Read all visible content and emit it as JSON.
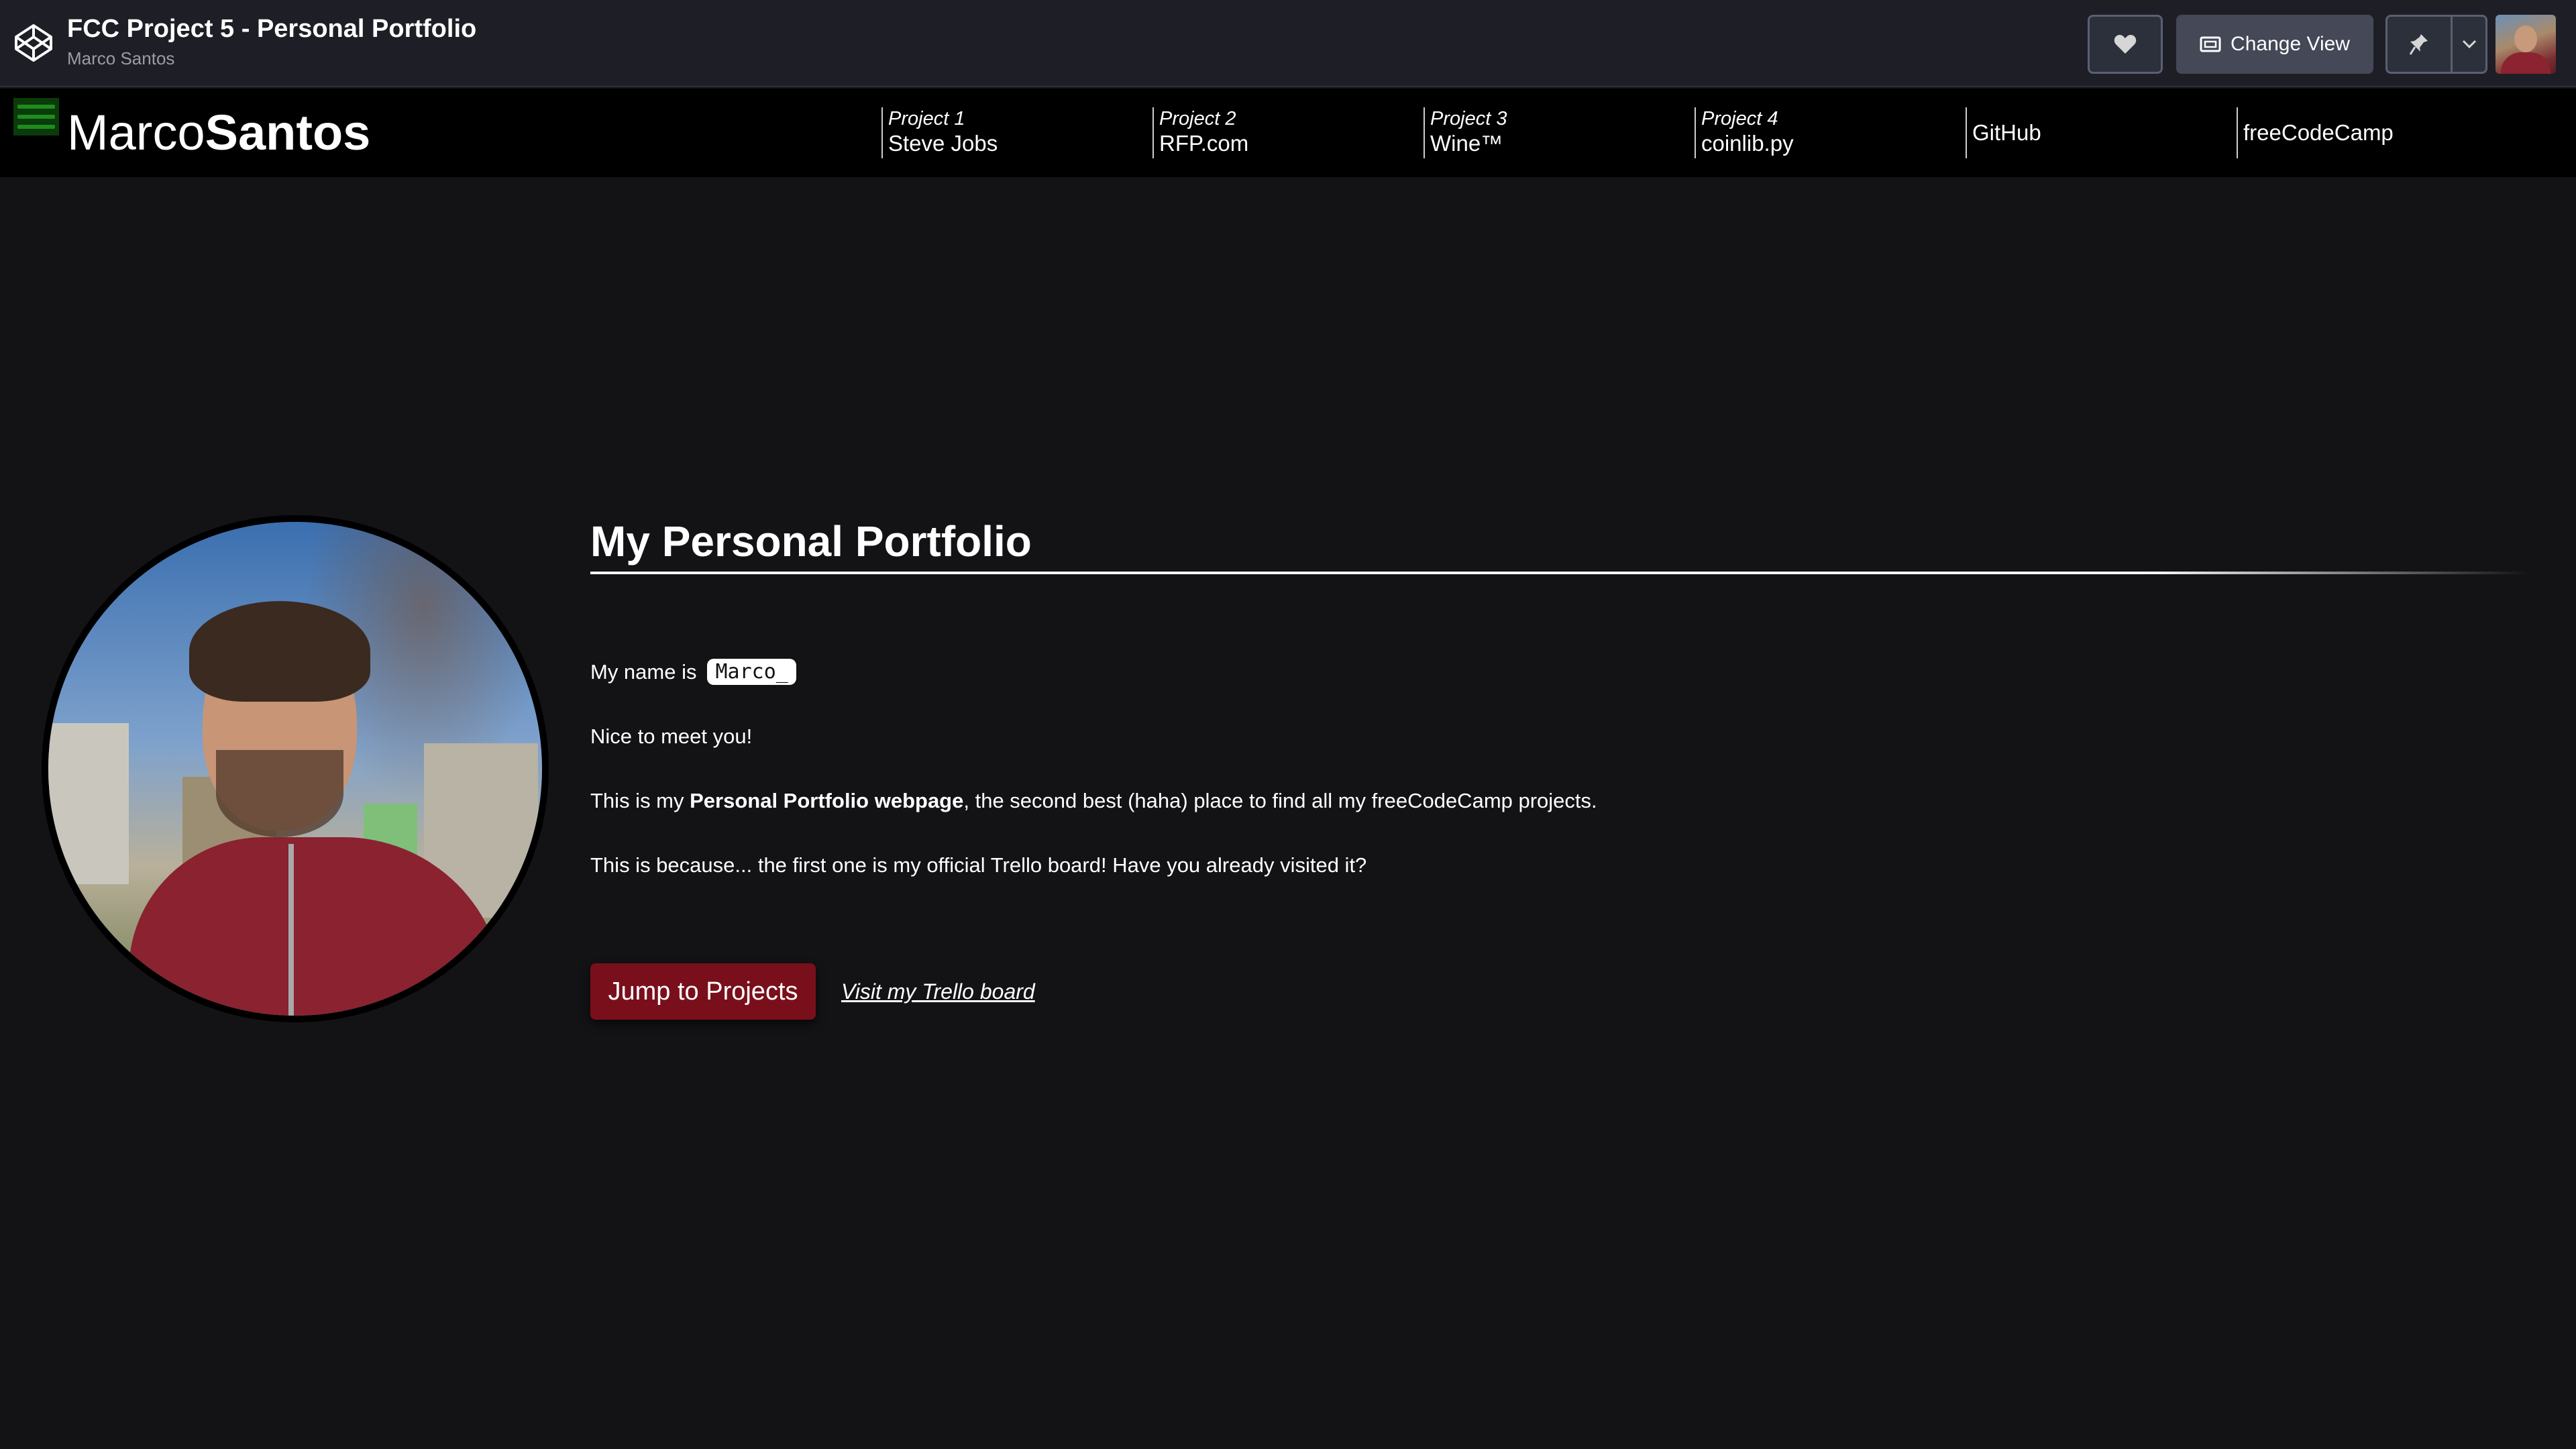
{
  "codepen_bar": {
    "pen_title": "FCC Project 5 - Personal Portfolio",
    "author": "Marco Santos",
    "change_view_label": "Change View"
  },
  "site_nav": {
    "brand_first": "Marco",
    "brand_last": "Santos",
    "links": [
      {
        "project": "Project 1",
        "name": "Steve Jobs"
      },
      {
        "project": "Project 2",
        "name": "RFP.com"
      },
      {
        "project": "Project 3",
        "name": "Wine™"
      },
      {
        "project": "Project 4",
        "name": "coinlib.py"
      }
    ],
    "github": "GitHub",
    "freecodecamp": "freeCodeCamp"
  },
  "main": {
    "title": "My Personal Portfolio",
    "name_prefix": "My name is",
    "typed_name": "Marco_",
    "greeting": "Nice to meet you!",
    "intro_before": "This is my ",
    "intro_bold": "Personal Portfolio webpage",
    "intro_after": ", the second best (haha) place to find all my freeCodeCamp projects.",
    "trello_note": "This is because... the first one is my official Trello board! Have you already visited it?",
    "jump_button": "Jump to Projects",
    "trello_link": "Visit my Trello board"
  },
  "colors": {
    "background": "#131315",
    "nav_background": "#000000",
    "codepen_bar": "#1e1f26",
    "accent_button": "#7a0f1c",
    "hamburger": "#1e8c1e"
  },
  "icons": {
    "codepen_logo": "codepen-logo-icon",
    "heart": "heart-icon",
    "change_view": "change-view-icon",
    "pin": "pin-icon",
    "caret": "chevron-down-icon",
    "menu": "hamburger-menu-icon"
  }
}
